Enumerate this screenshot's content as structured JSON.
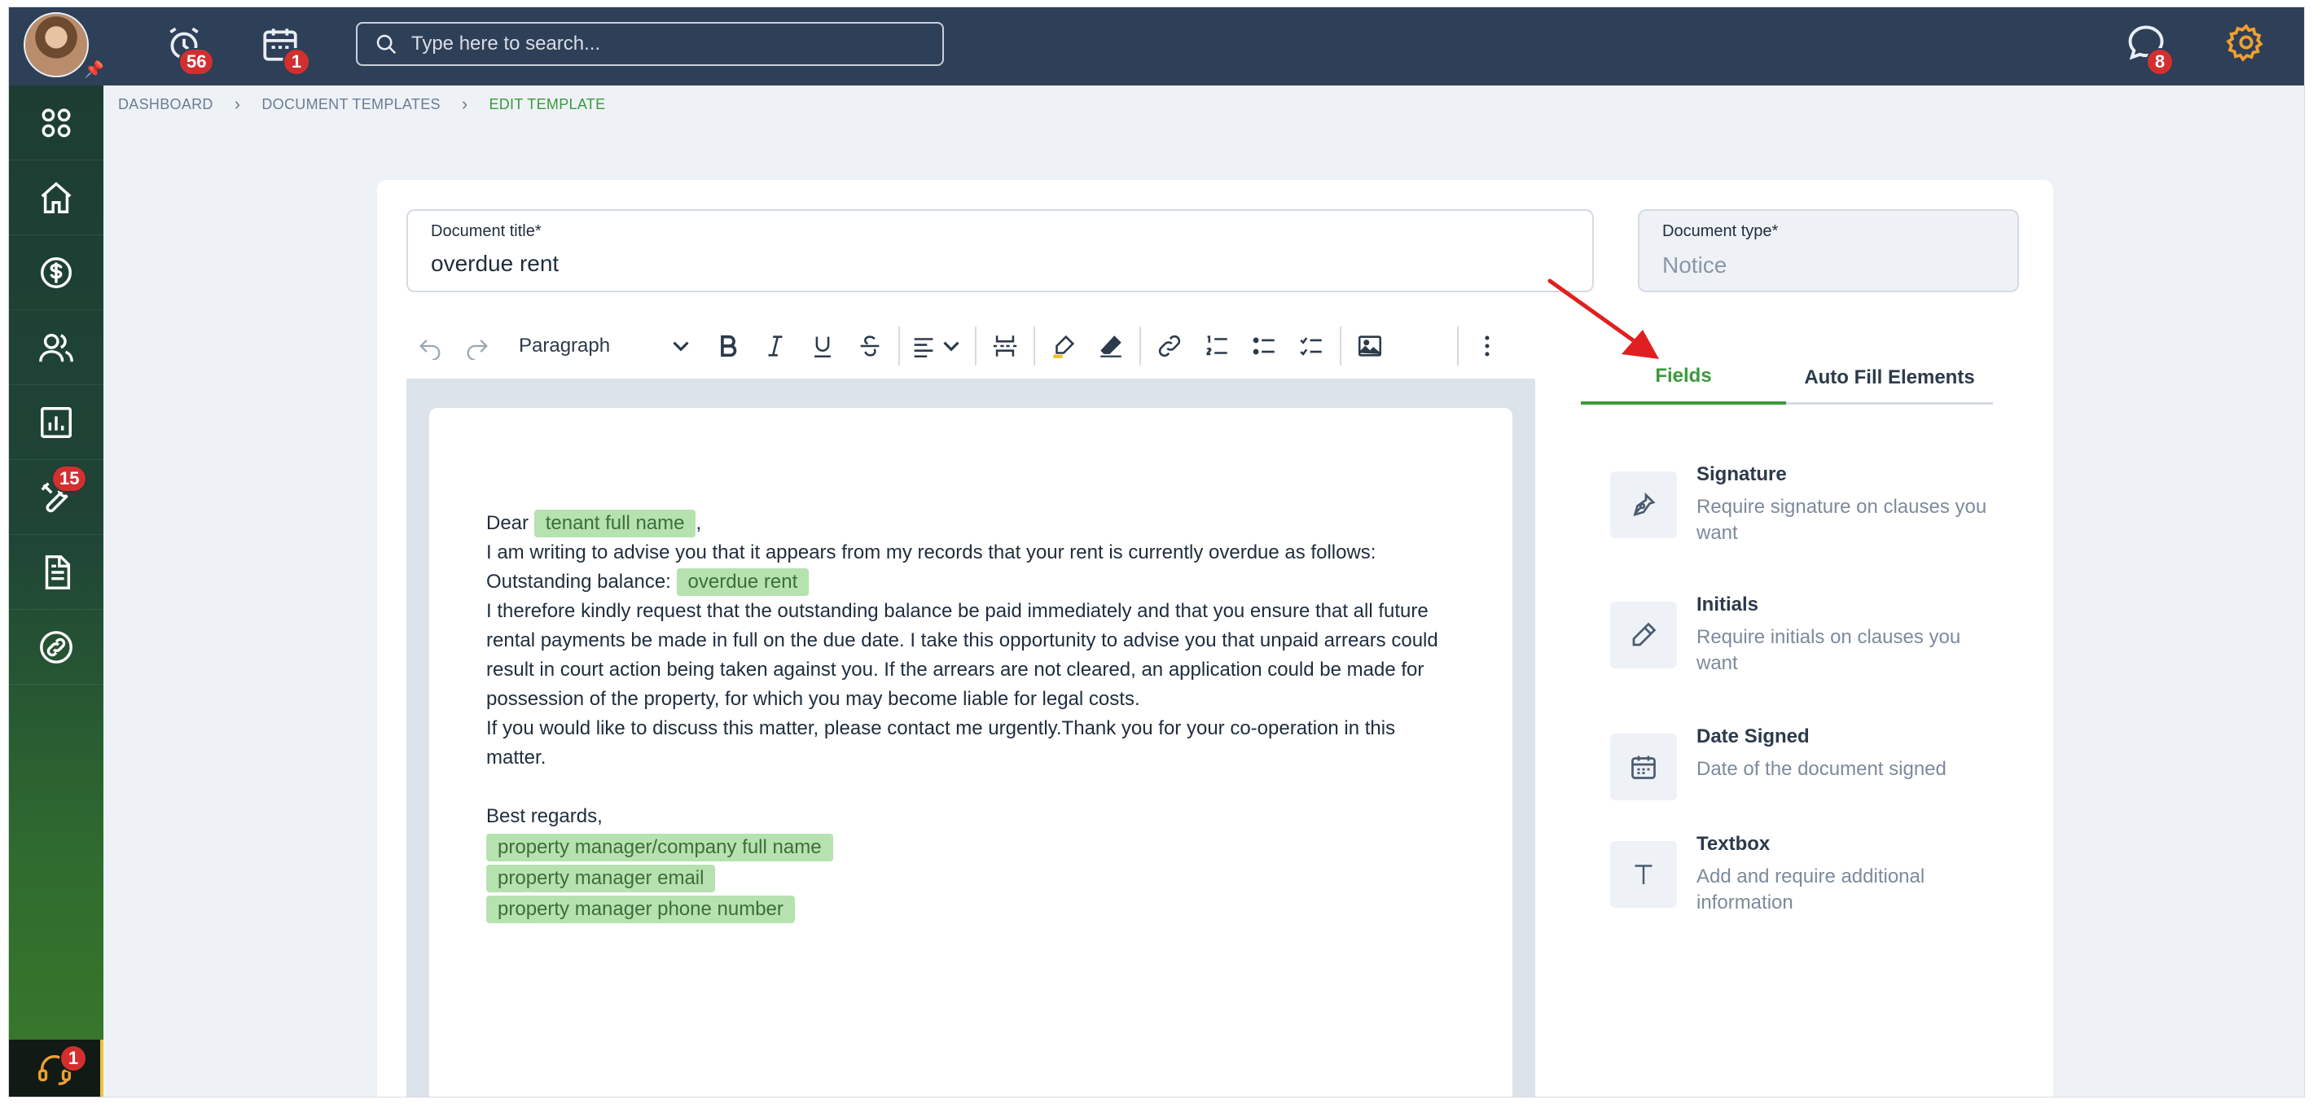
{
  "topbar": {
    "alarm_count": "56",
    "calendar_count": "1",
    "search_placeholder": "Type here to search...",
    "chat_count": "8"
  },
  "sidebar": {
    "tools_badge": "15",
    "support_badge": "1",
    "items": [
      "apps-icon",
      "home-icon",
      "dollar-icon",
      "users-icon",
      "chart-icon",
      "tools-icon",
      "document-icon",
      "link-icon"
    ]
  },
  "breadcrumb": {
    "items": [
      "DASHBOARD",
      "DOCUMENT TEMPLATES",
      "EDIT TEMPLATE"
    ]
  },
  "form": {
    "title_label": "Document title*",
    "title_value": "overdue rent",
    "type_label": "Document type*",
    "type_value": "Notice"
  },
  "toolbar": {
    "paragraph_label": "Paragraph"
  },
  "editor": {
    "dear": "Dear",
    "tag_tenant": "tenant full name",
    "comma": ",",
    "line2": "I am writing to advise you that it appears from my records that your rent is currently overdue as follows:",
    "outstanding": "Outstanding balance:",
    "tag_overdue": "overdue rent",
    "para1": "I therefore kindly request that the outstanding balance be paid immediately and that you ensure that all future rental payments be made in full on the due date. I take this opportunity to advise you that unpaid arrears could result in court action being taken against you. If the arrears are not cleared, an application could be made for possession of the property, for which you may become liable for legal costs.",
    "para2": "If you would like to discuss this matter, please contact me urgently.Thank you for your co-operation in this matter.",
    "regards": "Best regards,",
    "tag_company": "property manager/company full name",
    "tag_email": "property manager email",
    "tag_phone": "property manager phone number"
  },
  "tabs": {
    "fields": "Fields",
    "auto_fill": "Auto Fill Elements"
  },
  "fields": [
    {
      "title": "Signature",
      "desc": "Require signature on clauses you want"
    },
    {
      "title": "Initials",
      "desc": "Require initials on clauses you want"
    },
    {
      "title": "Date Signed",
      "desc": "Date of the document signed"
    },
    {
      "title": "Textbox",
      "desc": "Add and require additional information"
    }
  ],
  "colors": {
    "topbar": "#2e3f58",
    "accent_green": "#3a9a3a",
    "tag_green": "#b6e2b0",
    "badge_red": "#d32f2f",
    "gear_orange": "#f0a030"
  }
}
